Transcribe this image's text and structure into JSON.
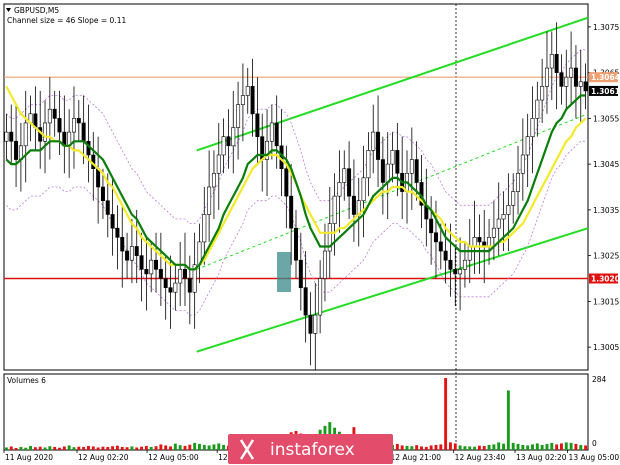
{
  "header": {
    "symbol": "GBPUSD,M5",
    "indicator": "Channel size = 46 Slope = 0.11"
  },
  "volume_panel": {
    "label": "Volumes 6",
    "max_label": "284",
    "zero_label": "0",
    "max": 284
  },
  "watermark": "instaforex",
  "colors": {
    "bull_candle": "#000000",
    "bear_candle": "#000000",
    "ema_green": "#0b7d0b",
    "sma_yellow": "#f2ea2a",
    "channel": "#22dd22",
    "envelope": "#c07ae0",
    "resistance": "#f0a070",
    "support": "#e01010",
    "volume_up": "#1a9a1a",
    "volume_down": "#e01414",
    "watermark_bg": "#e34c6a",
    "box": "#3a8a8a"
  },
  "chart_data": {
    "type": "candlestick",
    "symbol": "GBPUSD",
    "timeframe": "M5",
    "ylim": [
      1.3,
      1.308
    ],
    "y_ticks": [
      "1.3075",
      "1.3065",
      "1.3055",
      "1.3045",
      "1.3035",
      "1.3025",
      "1.3015",
      "1.3005"
    ],
    "x_tick_labels": [
      "11 Aug 2020",
      "12 Aug 02:20",
      "12 Aug 05:00",
      "12 Aug 07:40",
      "12 Aug",
      "12 Aug 21:00",
      "12 Aug 23:40",
      "13 Aug 02:20",
      "13 Aug 05:00"
    ],
    "price_labels": [
      {
        "text": "1.3064",
        "value": 1.3064
      },
      {
        "text": "1.3061",
        "value": 1.3061
      },
      {
        "text": "1.3020",
        "value": 1.302
      }
    ],
    "levels": {
      "resistance": 1.3064,
      "support": 1.302
    },
    "close": [
      1.3052,
      1.305,
      1.3046,
      1.3049,
      1.3054,
      1.3056,
      1.3053,
      1.305,
      1.3054,
      1.3057,
      1.3055,
      1.3052,
      1.3049,
      1.3052,
      1.3055,
      1.3054,
      1.305,
      1.3047,
      1.3044,
      1.304,
      1.3037,
      1.3034,
      1.3031,
      1.3029,
      1.3026,
      1.3024,
      1.3027,
      1.3025,
      1.3022,
      1.3021,
      1.3024,
      1.3022,
      1.302,
      1.3018,
      1.3017,
      1.3019,
      1.3022,
      1.302,
      1.3017,
      1.3023,
      1.3028,
      1.3034,
      1.304,
      1.3043,
      1.3047,
      1.3051,
      1.3049,
      1.3053,
      1.3058,
      1.306,
      1.3062,
      1.3056,
      1.3051,
      1.3046,
      1.305,
      1.3054,
      1.3049,
      1.3044,
      1.3038,
      1.3031,
      1.3024,
      1.3018,
      1.3012,
      1.3008,
      1.3012,
      1.302,
      1.3026,
      1.3032,
      1.3038,
      1.3041,
      1.3044,
      1.3038,
      1.3034,
      1.3037,
      1.3042,
      1.3048,
      1.3052,
      1.3046,
      1.3041,
      1.3045,
      1.3048,
      1.3043,
      1.3039,
      1.3043,
      1.3046,
      1.3041,
      1.3036,
      1.3033,
      1.303,
      1.3028,
      1.3026,
      1.3024,
      1.3022,
      1.3021,
      1.3022,
      1.3024,
      1.3027,
      1.3029,
      1.3028,
      1.3027,
      1.3029,
      1.3031,
      1.3033,
      1.3034,
      1.3036,
      1.3039,
      1.3043,
      1.3047,
      1.3051,
      1.3055,
      1.3059,
      1.3062,
      1.3066,
      1.3069,
      1.3065,
      1.3062,
      1.3064,
      1.3066,
      1.3062,
      1.3063,
      1.3061
    ],
    "ema_green": [
      1.3046,
      1.3045,
      1.3045,
      1.3046,
      1.3047,
      1.3048,
      1.3048,
      1.3048,
      1.3049,
      1.305,
      1.305,
      1.305,
      1.3049,
      1.3049,
      1.305,
      1.305,
      1.305,
      1.3049,
      1.3048,
      1.3047,
      1.3046,
      1.3044,
      1.3042,
      1.304,
      1.3038,
      1.3036,
      1.3034,
      1.3033,
      1.3031,
      1.3029,
      1.3028,
      1.3027,
      1.3026,
      1.3025,
      1.3024,
      1.3023,
      1.3023,
      1.3023,
      1.3022,
      1.3022,
      1.3023,
      1.3025,
      1.3027,
      1.3029,
      1.3031,
      1.3034,
      1.3036,
      1.3038,
      1.304,
      1.3042,
      1.3045,
      1.3046,
      1.3047,
      1.3047,
      1.3047,
      1.3048,
      1.3048,
      1.3047,
      1.3046,
      1.3044,
      1.3041,
      1.3038,
      1.3034,
      1.3031,
      1.3029,
      1.3027,
      1.3027,
      1.3027,
      1.3028,
      1.3029,
      1.303,
      1.3031,
      1.3032,
      1.3033,
      1.3034,
      1.3036,
      1.3038,
      1.3039,
      1.304,
      1.3041,
      1.3042,
      1.3042,
      1.3041,
      1.3041,
      1.304,
      1.3039,
      1.3038,
      1.3036,
      1.3035,
      1.3033,
      1.3031,
      1.3029,
      1.3028,
      1.3027,
      1.3026,
      1.3026,
      1.3026,
      1.3026,
      1.3026,
      1.3026,
      1.3026,
      1.3027,
      1.3028,
      1.3029,
      1.303,
      1.3031,
      1.3033,
      1.3035,
      1.3037,
      1.304,
      1.3043,
      1.3046,
      1.3049,
      1.3052,
      1.3054,
      1.3055,
      1.3057,
      1.3058,
      1.3059,
      1.306,
      1.306
    ],
    "sma_yellow": [
      1.3062,
      1.306,
      1.3058,
      1.3056,
      1.3055,
      1.3054,
      1.3053,
      1.3052,
      1.3051,
      1.3051,
      1.305,
      1.305,
      1.3049,
      1.3049,
      1.3048,
      1.3048,
      1.3047,
      1.3046,
      1.3045,
      1.3044,
      1.3043,
      1.3041,
      1.304,
      1.3038,
      1.3036,
      1.3034,
      1.3032,
      1.3031,
      1.3029,
      1.3028,
      1.3027,
      1.3026,
      1.3025,
      1.3024,
      1.3023,
      1.3023,
      1.3023,
      1.3023,
      1.3022,
      1.3022,
      1.3023,
      1.3024,
      1.3026,
      1.3028,
      1.303,
      1.3032,
      1.3034,
      1.3036,
      1.3038,
      1.304,
      1.3042,
      1.3044,
      1.3045,
      1.3046,
      1.3047,
      1.3047,
      1.3047,
      1.3046,
      1.3045,
      1.3043,
      1.3041,
      1.3038,
      1.3036,
      1.3034,
      1.3032,
      1.303,
      1.303,
      1.303,
      1.303,
      1.3031,
      1.3031,
      1.3032,
      1.3033,
      1.3034,
      1.3035,
      1.3036,
      1.3037,
      1.3038,
      1.3039,
      1.3039,
      1.304,
      1.304,
      1.304,
      1.3039,
      1.3039,
      1.3038,
      1.3037,
      1.3036,
      1.3035,
      1.3034,
      1.3033,
      1.3031,
      1.303,
      1.3029,
      1.3028,
      1.3028,
      1.3027,
      1.3027,
      1.3027,
      1.3027,
      1.3027,
      1.3027,
      1.3028,
      1.3028,
      1.3029,
      1.303,
      1.3031,
      1.3032,
      1.3034,
      1.3036,
      1.3038,
      1.304,
      1.3042,
      1.3044,
      1.3046,
      1.3048,
      1.305,
      1.3051,
      1.3053,
      1.3054,
      1.3055
    ],
    "channel": {
      "upper": [
        [
          0.33,
          1.3048
        ],
        [
          1.0,
          1.3077
        ]
      ],
      "middle": [
        [
          0.33,
          1.3022
        ],
        [
          1.0,
          1.3056
        ]
      ],
      "lower": [
        [
          0.33,
          1.3004
        ],
        [
          1.0,
          1.3031
        ]
      ]
    },
    "volumes": [
      10,
      14,
      8,
      12,
      9,
      16,
      11,
      13,
      10,
      15,
      12,
      9,
      14,
      18,
      11,
      13,
      12,
      16,
      14,
      10,
      13,
      12,
      15,
      17,
      12,
      11,
      14,
      10,
      13,
      16,
      12,
      15,
      22,
      18,
      14,
      25,
      19,
      16,
      21,
      28,
      24,
      20,
      18,
      22,
      26,
      20,
      17,
      21,
      24,
      30,
      35,
      28,
      25,
      32,
      40,
      38,
      45,
      52,
      60,
      70,
      75,
      65,
      55,
      58,
      62,
      80,
      95,
      110,
      88,
      72,
      60,
      55,
      90,
      50,
      42,
      38,
      30,
      28,
      25,
      22,
      20,
      24,
      18,
      16,
      15,
      19,
      14,
      12,
      18,
      20,
      22,
      284,
      30,
      26,
      18,
      15,
      14,
      13,
      17,
      16,
      20,
      22,
      30,
      25,
      235,
      28,
      24,
      20,
      18,
      22,
      26,
      20,
      24,
      28,
      22,
      26,
      30,
      28,
      24,
      20,
      18
    ]
  }
}
